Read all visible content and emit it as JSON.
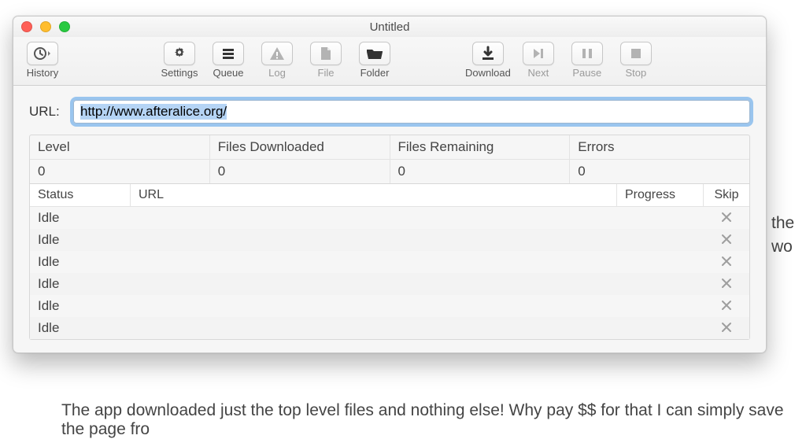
{
  "window": {
    "title": "Untitled"
  },
  "toolbar": {
    "history": {
      "label": "History"
    },
    "settings": {
      "label": "Settings"
    },
    "queue": {
      "label": "Queue"
    },
    "log": {
      "label": "Log"
    },
    "file": {
      "label": "File"
    },
    "folder": {
      "label": "Folder"
    },
    "download": {
      "label": "Download"
    },
    "next": {
      "label": "Next"
    },
    "pause": {
      "label": "Pause"
    },
    "stop": {
      "label": "Stop"
    }
  },
  "url_field": {
    "label": "URL:",
    "value": "http://www.afteralice.org/"
  },
  "stats": {
    "headers": {
      "level": "Level",
      "files_downloaded": "Files Downloaded",
      "files_remaining": "Files Remaining",
      "errors": "Errors"
    },
    "values": {
      "level": "0",
      "files_downloaded": "0",
      "files_remaining": "0",
      "errors": "0"
    }
  },
  "tasks": {
    "headers": {
      "status": "Status",
      "url": "URL",
      "progress": "Progress",
      "skip": "Skip"
    },
    "rows": [
      {
        "status": "Idle",
        "url": "",
        "progress": ""
      },
      {
        "status": "Idle",
        "url": "",
        "progress": ""
      },
      {
        "status": "Idle",
        "url": "",
        "progress": ""
      },
      {
        "status": "Idle",
        "url": "",
        "progress": ""
      },
      {
        "status": "Idle",
        "url": "",
        "progress": ""
      },
      {
        "status": "Idle",
        "url": "",
        "progress": ""
      }
    ]
  },
  "background_text": {
    "line1a": "the",
    "line1b": "wo",
    "line2": "The app downloaded just the top level files and nothing else! Why pay $$ for that I can simply save the page fro"
  }
}
